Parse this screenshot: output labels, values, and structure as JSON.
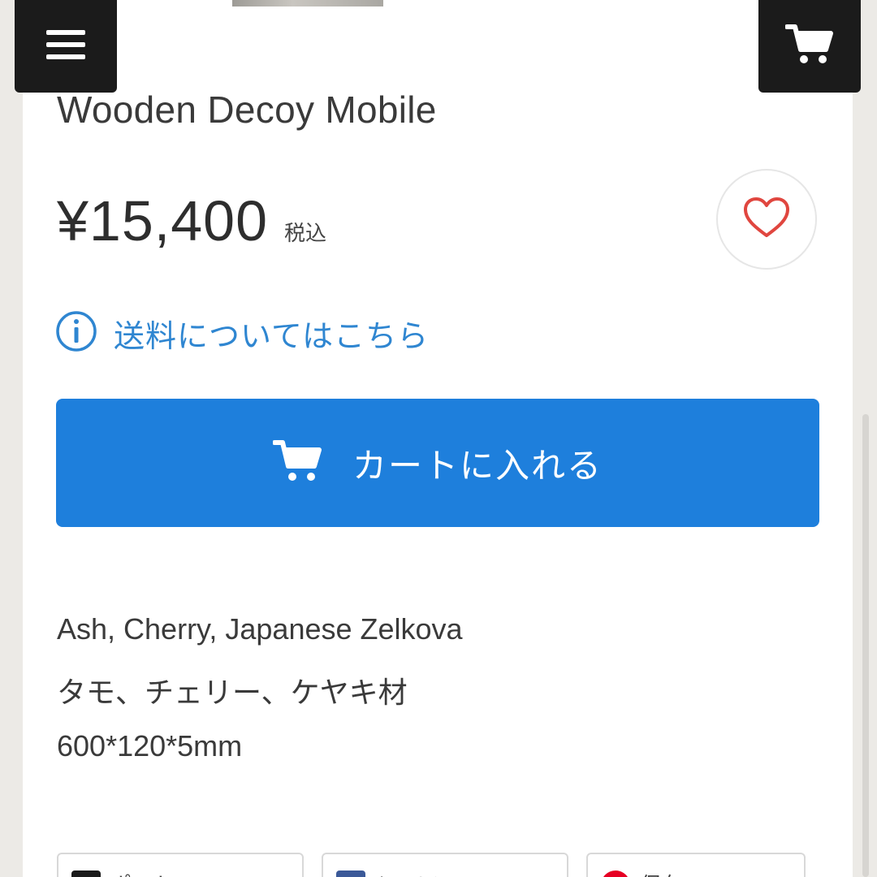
{
  "header": {
    "menu_icon": "hamburger-menu-icon",
    "cart_icon": "shopping-cart-icon"
  },
  "product": {
    "title": "Wooden Decoy Mobile",
    "price": "¥15,400",
    "tax_label": "税込",
    "favorite_icon": "heart-icon",
    "favorite_color": "#e0463f"
  },
  "shipping": {
    "icon": "info-icon",
    "link_text": "送料についてはこちら",
    "color": "#2f86d1"
  },
  "cart_button": {
    "label": "カートに入れる",
    "icon": "shopping-cart-icon",
    "color": "#1e7fdc"
  },
  "description": {
    "lines": [
      "Ash, Cherry, Japanese Zelkova",
      "タモ、チェリー、ケヤキ材",
      "600*120*5mm"
    ]
  },
  "share": {
    "buttons": [
      {
        "label": "ポスト",
        "icon": "x-post-icon",
        "color": "#1b1b1b"
      },
      {
        "label": "シェア",
        "icon": "facebook-icon",
        "color": "#3b5998"
      },
      {
        "label": "保存",
        "icon": "pinterest-icon",
        "color": "#e60023"
      }
    ]
  }
}
